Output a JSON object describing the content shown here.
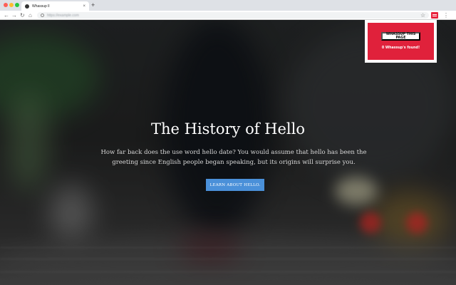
{
  "browser": {
    "tab_title": "Whassup ll",
    "tab_close": "×",
    "new_tab": "+",
    "url": "https://example.com",
    "icons": {
      "back": "←",
      "forward": "→",
      "reload": "↻",
      "home": "⌂",
      "star": "☆",
      "menu": "⋮"
    }
  },
  "page": {
    "title": "The History of Hello",
    "lead": "How far back does the use word hello date? You would assume that hello has been the greeting since English people began speaking, but its origins will surprise you.",
    "cta_label": "LEARN ABOUT HELLO."
  },
  "extension_popup": {
    "button_label": "WHASSUP THIS PAGE",
    "message": "0 Whassup's found!",
    "accent_color": "#e0213b"
  },
  "colors": {
    "cta": "#4a90d9"
  }
}
